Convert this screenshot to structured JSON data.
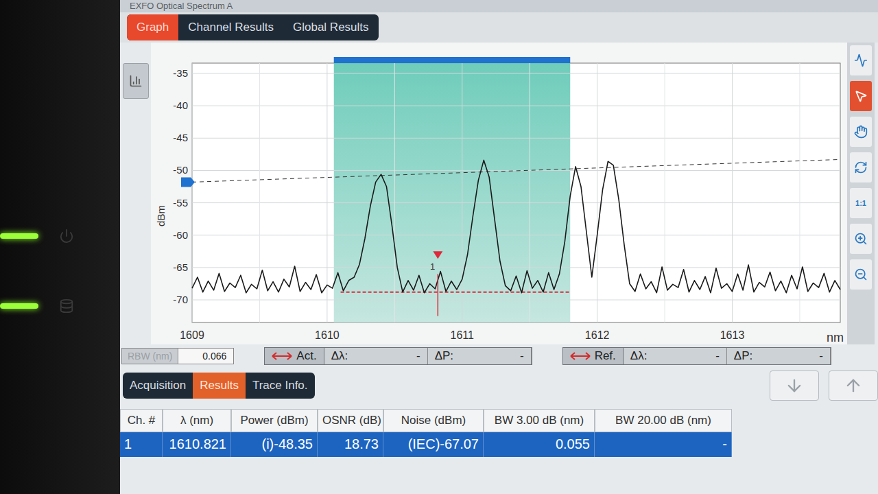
{
  "window": {
    "title": "EXFO Optical Spectrum A"
  },
  "bezel": {
    "indicators": [
      {
        "on": true
      },
      {
        "on": true
      }
    ]
  },
  "tabs": [
    {
      "label": "Graph",
      "selected": true
    },
    {
      "label": "Channel Results",
      "selected": false
    },
    {
      "label": "Global Results",
      "selected": false
    }
  ],
  "tools": [
    {
      "selected": false
    },
    {
      "selected": true
    },
    {
      "selected": false
    },
    {
      "selected": false
    },
    {
      "label": "1:1",
      "selected": false
    },
    {
      "selected": false
    },
    {
      "selected": false
    }
  ],
  "chart": {
    "y_label": "dBm",
    "x_unit": "nm",
    "y_ticks": [
      "-35",
      "-40",
      "-45",
      "-50",
      "-55",
      "-60",
      "-65",
      "-70"
    ],
    "x_ticks": [
      "1609",
      "1610",
      "1611",
      "1612",
      "1613"
    ],
    "x_start": 1609,
    "x_step": 0.04,
    "trace": [
      -68.2,
      -66.5,
      -68.8,
      -67.1,
      -68.5,
      -65.9,
      -68.7,
      -67.4,
      -68.1,
      -66.2,
      -68.9,
      -67.6,
      -68.3,
      -65.4,
      -68.6,
      -67.2,
      -68.8,
      -66.8,
      -68.0,
      -64.8,
      -68.7,
      -67.3,
      -68.4,
      -66.1,
      -68.9,
      -67.7,
      -68.2,
      -65.8,
      -68.6,
      -67.0,
      -66.5,
      -64.5,
      -60.5,
      -55.5,
      -51.8,
      -50.6,
      -52.5,
      -58.5,
      -65.0,
      -68.8,
      -67.0,
      -68.5,
      -66.2,
      -68.9,
      -67.5,
      -68.3,
      -65.6,
      -68.7,
      -67.1,
      -68.4,
      -66.8,
      -63.0,
      -57.0,
      -51.5,
      -48.4,
      -51.0,
      -57.5,
      -64.0,
      -67.8,
      -68.6,
      -66.3,
      -68.9,
      -65.5,
      -68.2,
      -67.0,
      -68.8,
      -65.8,
      -68.4,
      -66.0,
      -61.0,
      -54.0,
      -49.4,
      -52.5,
      -59.5,
      -66.5,
      -60.0,
      -53.0,
      -48.6,
      -49.2,
      -54.5,
      -61.5,
      -67.5,
      -68.7,
      -66.0,
      -68.3,
      -67.2,
      -68.9,
      -64.9,
      -68.5,
      -67.6,
      -68.1,
      -65.3,
      -68.8,
      -67.0,
      -68.4,
      -66.4,
      -68.9,
      -65.1,
      -68.2,
      -67.5,
      -68.7,
      -66.0,
      -68.5,
      -64.6,
      -68.8,
      -67.3,
      -68.0,
      -65.7,
      -68.6,
      -67.1,
      -68.9,
      -66.2,
      -68.3,
      -64.9,
      -68.7,
      -67.4,
      -68.1,
      -65.9,
      -68.8,
      -67.0,
      -68.4
    ],
    "selection": {
      "from": 1610.05,
      "to": 1611.8
    },
    "reference_line": [
      -51.8,
      -48.3
    ],
    "noise_line": {
      "from": 1610.1,
      "to": 1611.8,
      "dbm": -68.8
    },
    "marker": {
      "label": "1",
      "at": 1610.82
    }
  },
  "marker_bar": {
    "rbw": {
      "label": "RBW (nm)",
      "value": "0.066"
    },
    "groups": [
      {
        "label": "Act.",
        "fields": [
          {
            "label": "Δλ:",
            "value": "-"
          },
          {
            "label": "ΔP:",
            "value": "-"
          }
        ]
      },
      {
        "label": "Ref.",
        "fields": [
          {
            "label": "Δλ:",
            "value": "-"
          },
          {
            "label": "ΔP:",
            "value": "-"
          }
        ]
      }
    ]
  },
  "bottom_tabs": [
    {
      "label": "Acquisition",
      "selected": false
    },
    {
      "label": "Results",
      "selected": true
    },
    {
      "label": "Trace Info.",
      "selected": false
    }
  ],
  "table": {
    "columns": [
      "Ch. #",
      "λ (nm)",
      "Power (dBm)",
      "OSNR (dB)",
      "Noise (dBm)",
      "BW 3.00 dB (nm)",
      "BW 20.00 dB (nm)"
    ],
    "rows": [
      {
        "cells": [
          "1",
          "1610.821",
          "(i)-48.35",
          "18.73",
          "(IEC)-67.07",
          "0.055",
          "-"
        ],
        "selected": true
      }
    ]
  }
}
